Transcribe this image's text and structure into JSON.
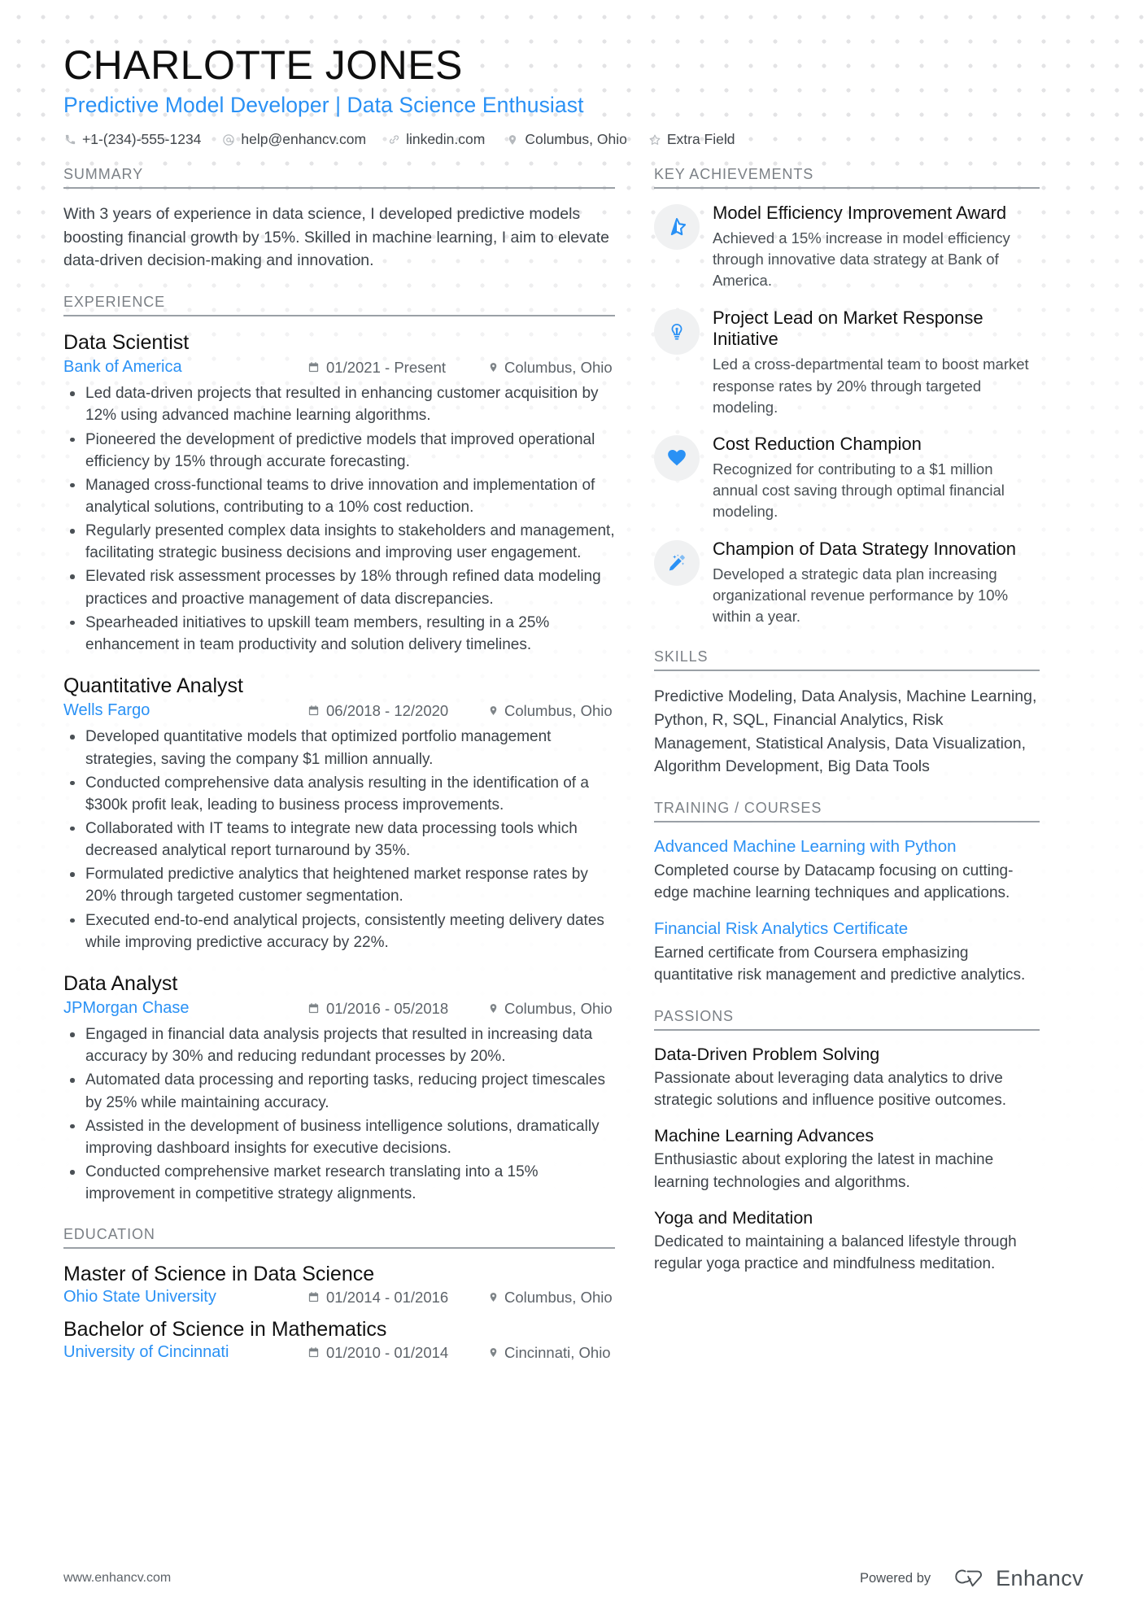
{
  "colors": {
    "accent": "#2a91f5",
    "heading": "#111111",
    "body": "#3d4349",
    "muted": "#7b8086",
    "rule": "#9aa0a6",
    "icon_bg": "#f0f1f2"
  },
  "header": {
    "name": "CHARLOTTE JONES",
    "headline": "Predictive Model Developer | Data Science Enthusiast",
    "contacts": [
      {
        "icon": "phone-icon",
        "text": "+1-(234)-555-1234"
      },
      {
        "icon": "email-icon",
        "text": "help@enhancv.com"
      },
      {
        "icon": "link-icon",
        "text": "linkedin.com"
      },
      {
        "icon": "location-pin-icon",
        "text": "Columbus, Ohio"
      },
      {
        "icon": "star-outline-icon",
        "text": "Extra Field"
      }
    ]
  },
  "left": {
    "summary": {
      "heading": "SUMMARY",
      "text": "With 3 years of experience in data science, I developed predictive models boosting financial growth by 15%. Skilled in machine learning, I aim to elevate data-driven decision-making and innovation."
    },
    "experience": {
      "heading": "EXPERIENCE",
      "entries": [
        {
          "title": "Data Scientist",
          "organization": "Bank of America",
          "dates": "01/2021 - Present",
          "location": "Columbus, Ohio",
          "bullets": [
            "Led data-driven projects that resulted in enhancing customer acquisition by 12% using advanced machine learning algorithms.",
            "Pioneered the development of predictive models that improved operational efficiency by 15% through accurate forecasting.",
            "Managed cross-functional teams to drive innovation and implementation of analytical solutions, contributing to a 10% cost reduction.",
            "Regularly presented complex data insights to stakeholders and management, facilitating strategic business decisions and improving user engagement.",
            "Elevated risk assessment processes by 18% through refined data modeling practices and proactive management of data discrepancies.",
            "Spearheaded initiatives to upskill team members, resulting in a 25% enhancement in team productivity and solution delivery timelines."
          ]
        },
        {
          "title": "Quantitative Analyst",
          "organization": "Wells Fargo",
          "dates": "06/2018 - 12/2020",
          "location": "Columbus, Ohio",
          "bullets": [
            "Developed quantitative models that optimized portfolio management strategies, saving the company $1 million annually.",
            "Conducted comprehensive data analysis resulting in the identification of a $300k profit leak, leading to business process improvements.",
            "Collaborated with IT teams to integrate new data processing tools which decreased analytical report turnaround by 35%.",
            "Formulated predictive analytics that heightened market response rates by 20% through targeted customer segmentation.",
            "Executed end-to-end analytical projects, consistently meeting delivery dates while improving predictive accuracy by 22%."
          ]
        },
        {
          "title": "Data Analyst",
          "organization": "JPMorgan Chase",
          "dates": "01/2016 - 05/2018",
          "location": "Columbus, Ohio",
          "bullets": [
            "Engaged in financial data analysis projects that resulted in increasing data accuracy by 30% and reducing redundant processes by 20%.",
            "Automated data processing and reporting tasks, reducing project timescales by 25% while maintaining accuracy.",
            "Assisted in the development of business intelligence solutions, dramatically improving dashboard insights for executive decisions.",
            "Conducted comprehensive market research translating into a 15% improvement in competitive strategy alignments."
          ]
        }
      ]
    },
    "education": {
      "heading": "EDUCATION",
      "entries": [
        {
          "title": "Master of Science in Data Science",
          "organization": "Ohio State University",
          "dates": "01/2014 - 01/2016",
          "location": "Columbus, Ohio"
        },
        {
          "title": "Bachelor of Science in Mathematics",
          "organization": "University of Cincinnati",
          "dates": "01/2010 - 01/2014",
          "location": "Cincinnati, Ohio"
        }
      ]
    }
  },
  "right": {
    "achievements": {
      "heading": "KEY ACHIEVEMENTS",
      "items": [
        {
          "icon": "star-icon",
          "title": "Model Efficiency Improvement Award",
          "description": "Achieved a 15% increase in model efficiency through innovative data strategy at Bank of America."
        },
        {
          "icon": "lightbulb-icon",
          "title": "Project Lead on Market Response Initiative",
          "description": "Led a cross-departmental team to boost market response rates by 20% through targeted modeling."
        },
        {
          "icon": "heart-icon",
          "title": "Cost Reduction Champion",
          "description": "Recognized for contributing to a $1 million annual cost saving through optimal financial modeling."
        },
        {
          "icon": "magic-wand-icon",
          "title": "Champion of Data Strategy Innovation",
          "description": "Developed a strategic data plan increasing organizational revenue performance by 10% within a year."
        }
      ]
    },
    "skills": {
      "heading": "SKILLS",
      "text": "Predictive Modeling, Data Analysis, Machine Learning, Python, R, SQL, Financial Analytics, Risk Management, Statistical Analysis, Data Visualization, Algorithm Development, Big Data Tools"
    },
    "training": {
      "heading": "TRAINING / COURSES",
      "items": [
        {
          "title": "Advanced Machine Learning with Python",
          "description": "Completed course by Datacamp focusing on cutting-edge machine learning techniques and applications."
        },
        {
          "title": "Financial Risk Analytics Certificate",
          "description": "Earned certificate from Coursera emphasizing quantitative risk management and predictive analytics."
        }
      ]
    },
    "passions": {
      "heading": "PASSIONS",
      "items": [
        {
          "title": "Data-Driven Problem Solving",
          "description": "Passionate about leveraging data analytics to drive strategic solutions and influence positive outcomes."
        },
        {
          "title": "Machine Learning Advances",
          "description": "Enthusiastic about exploring the latest in machine learning technologies and algorithms."
        },
        {
          "title": "Yoga and Meditation",
          "description": "Dedicated to maintaining a balanced lifestyle through regular yoga practice and mindfulness meditation."
        }
      ]
    }
  },
  "footer": {
    "url": "www.enhancv.com",
    "powered_by": "Powered by",
    "brand": "Enhancv"
  }
}
